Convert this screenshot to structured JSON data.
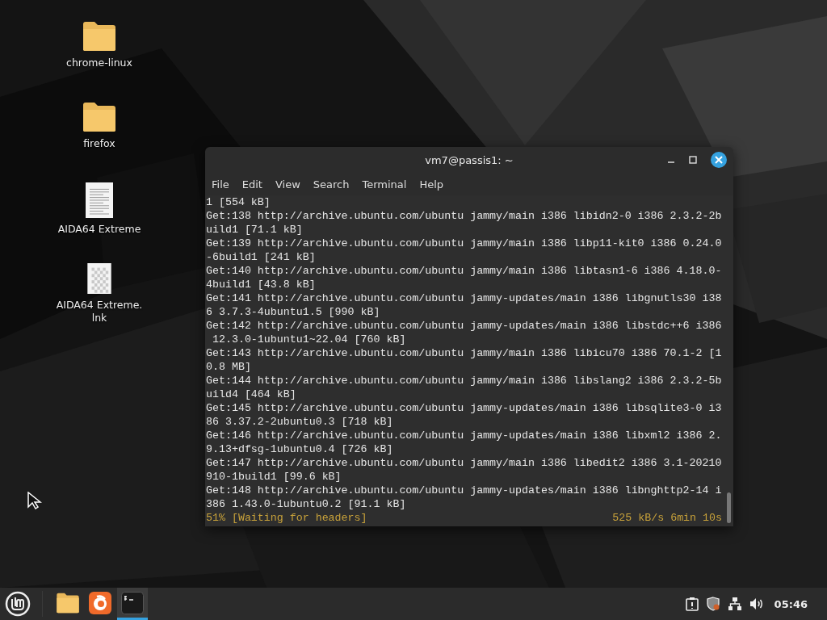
{
  "desktop_icons": [
    {
      "kind": "folder",
      "label": "chrome-linux"
    },
    {
      "kind": "folder",
      "label": "firefox"
    },
    {
      "kind": "document",
      "label": "AIDA64 Extreme"
    },
    {
      "kind": "checkered",
      "label": "AIDA64 Extreme.\nlnk"
    }
  ],
  "terminal": {
    "title": "vm7@passis1: ~",
    "menu": [
      "File",
      "Edit",
      "View",
      "Search",
      "Terminal",
      "Help"
    ],
    "lines": [
      "1 [554 kB]",
      "Get:138 http://archive.ubuntu.com/ubuntu jammy/main i386 libidn2-0 i386 2.3.2-2b",
      "uild1 [71.1 kB]",
      "Get:139 http://archive.ubuntu.com/ubuntu jammy/main i386 libp11-kit0 i386 0.24.0",
      "-6build1 [241 kB]",
      "Get:140 http://archive.ubuntu.com/ubuntu jammy/main i386 libtasn1-6 i386 4.18.0-",
      "4build1 [43.8 kB]",
      "Get:141 http://archive.ubuntu.com/ubuntu jammy-updates/main i386 libgnutls30 i38",
      "6 3.7.3-4ubuntu1.5 [990 kB]",
      "Get:142 http://archive.ubuntu.com/ubuntu jammy-updates/main i386 libstdc++6 i386",
      " 12.3.0-1ubuntu1~22.04 [760 kB]",
      "Get:143 http://archive.ubuntu.com/ubuntu jammy/main i386 libicu70 i386 70.1-2 [1",
      "0.8 MB]",
      "Get:144 http://archive.ubuntu.com/ubuntu jammy/main i386 libslang2 i386 2.3.2-5b",
      "uild4 [464 kB]",
      "Get:145 http://archive.ubuntu.com/ubuntu jammy-updates/main i386 libsqlite3-0 i3",
      "86 3.37.2-2ubuntu0.3 [718 kB]",
      "Get:146 http://archive.ubuntu.com/ubuntu jammy-updates/main i386 libxml2 i386 2.",
      "9.13+dfsg-1ubuntu0.4 [726 kB]",
      "Get:147 http://archive.ubuntu.com/ubuntu jammy/main i386 libedit2 i386 3.1-20210",
      "910-1build1 [99.6 kB]",
      "Get:148 http://archive.ubuntu.com/ubuntu jammy-updates/main i386 libnghttp2-14 i",
      "386 1.43.0-1ubuntu0.2 [91.1 kB]"
    ],
    "progress": {
      "status": "51% [Waiting for headers]",
      "rate": "525 kB/s 6min 10s"
    }
  },
  "taskbar": {
    "apps": [
      {
        "kind": "folder",
        "selected": false
      },
      {
        "kind": "browser",
        "selected": false
      },
      {
        "kind": "terminal",
        "selected": true
      }
    ],
    "clock": "05:46"
  }
}
